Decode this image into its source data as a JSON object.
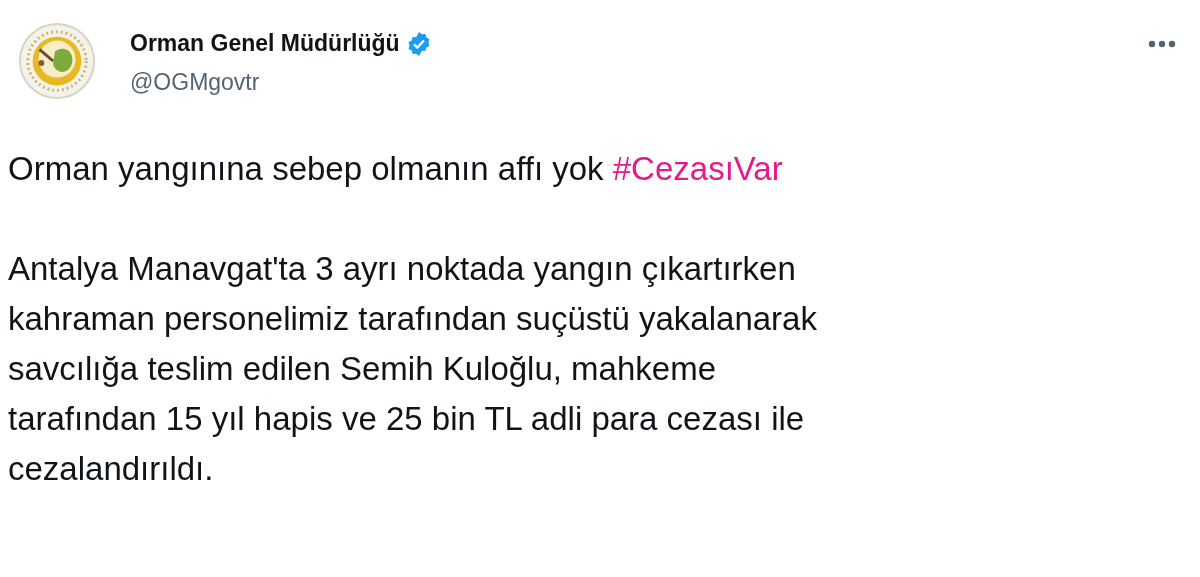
{
  "author": {
    "name": "Orman Genel Müdürlüğü",
    "verified": true,
    "handle": "@OGMgovtr"
  },
  "paragraphs": [
    {
      "text": "Orman yangınına sebep olmanın affı yok ",
      "hashtag": "#CezasıVar"
    },
    {
      "text": "Antalya Manavgat'ta 3 ayrı noktada yangın çıkartırken\nkahraman personelimiz tarafından suçüstü yakalanarak\nsavcılığa teslim edilen Semih Kuloğlu, mahkeme\ntarafından 15 yıl hapis ve 25 bin TL adli para cezası ile\ncezalandırıldı."
    }
  ]
}
